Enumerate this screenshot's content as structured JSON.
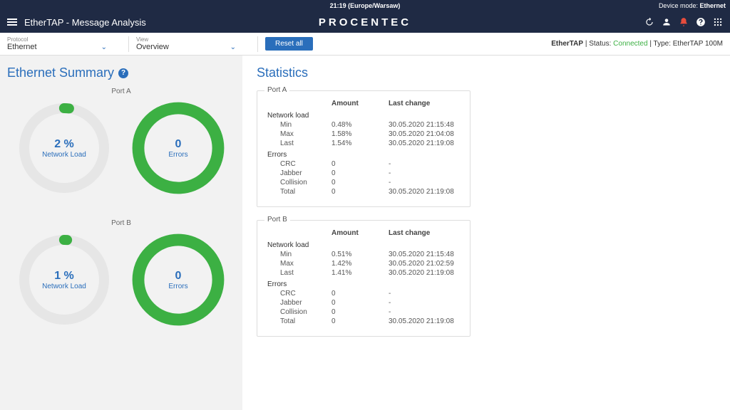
{
  "topbar": {
    "time": "21:19 (Europe/Warsaw)",
    "device_mode_label": "Device mode:",
    "device_mode_value": "Ethernet"
  },
  "header": {
    "brand": "PROCENTEC",
    "page_title": "EtherTAP - Message Analysis"
  },
  "filters": {
    "protocol_label": "Protocol",
    "protocol_value": "Ethernet",
    "view_label": "View",
    "view_value": "Overview",
    "reset_label": "Reset all"
  },
  "status": {
    "device": "EtherTAP",
    "status_label": "Status:",
    "status_value": "Connected",
    "type_label": "Type:",
    "type_value": "EtherTAP 100M"
  },
  "summary": {
    "title": "Ethernet Summary",
    "port_a_label": "Port A",
    "port_b_label": "Port B",
    "rings": {
      "a_load_val": "2 %",
      "a_load_lbl": "Network Load",
      "a_err_val": "0",
      "a_err_lbl": "Errors",
      "b_load_val": "1 %",
      "b_load_lbl": "Network Load",
      "b_err_val": "0",
      "b_err_lbl": "Errors"
    }
  },
  "stats": {
    "title": "Statistics",
    "headers": {
      "amount": "Amount",
      "last_change": "Last change"
    },
    "groups": {
      "network_load": "Network load",
      "errors": "Errors"
    },
    "rows": {
      "min": "Min",
      "max": "Max",
      "last": "Last",
      "crc": "CRC",
      "jabber": "Jabber",
      "collision": "Collision",
      "total": "Total"
    },
    "port_a": {
      "legend": "Port A",
      "min_amt": "0.48%",
      "min_ts": "30.05.2020 21:15:48",
      "max_amt": "1.58%",
      "max_ts": "30.05.2020 21:04:08",
      "last_amt": "1.54%",
      "last_ts": "30.05.2020 21:19:08",
      "crc_amt": "0",
      "crc_ts": "-",
      "jab_amt": "0",
      "jab_ts": "-",
      "col_amt": "0",
      "col_ts": "-",
      "tot_amt": "0",
      "tot_ts": "30.05.2020 21:19:08"
    },
    "port_b": {
      "legend": "Port B",
      "min_amt": "0.51%",
      "min_ts": "30.05.2020 21:15:48",
      "max_amt": "1.42%",
      "max_ts": "30.05.2020 21:02:59",
      "last_amt": "1.41%",
      "last_ts": "30.05.2020 21:19:08",
      "crc_amt": "0",
      "crc_ts": "-",
      "jab_amt": "0",
      "jab_ts": "-",
      "col_amt": "0",
      "col_ts": "-",
      "tot_amt": "0",
      "tot_ts": "30.05.2020 21:19:08"
    }
  },
  "colors": {
    "accent": "#2a6ebb",
    "ok_green": "#3cb043",
    "ring_gray": "#e6e6e6",
    "dark": "#1f2a44"
  }
}
